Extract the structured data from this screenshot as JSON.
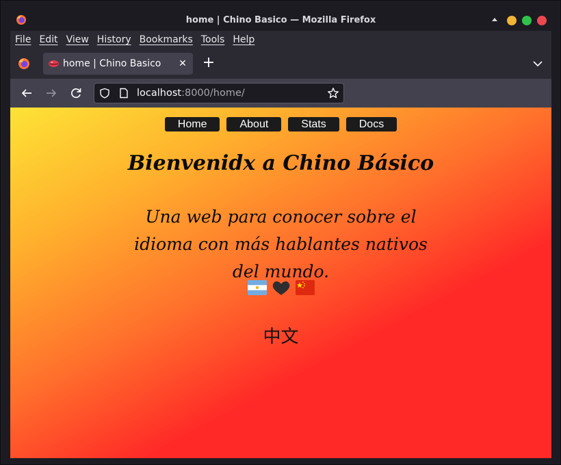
{
  "window": {
    "title": "home | Chino Basico — Mozilla Firefox"
  },
  "menu": [
    "File",
    "Edit",
    "View",
    "History",
    "Bookmarks",
    "Tools",
    "Help"
  ],
  "tab": {
    "title": "home | Chino Basico",
    "close_glyph": "✕",
    "new_tab_glyph": "+"
  },
  "urlbar": {
    "host": "localhost",
    "rest": ":8000/home/"
  },
  "page": {
    "nav": [
      "Home",
      "About",
      "Stats",
      "Docs"
    ],
    "heading": "Bienvenidx a Chino Básico",
    "subheading": "Una web para conocer sobre el idioma con más hablantes nativos del mundo.",
    "chinese": "中文",
    "flags": [
      "argentina-flag",
      "black-heart-icon",
      "china-flag"
    ]
  },
  "colors": {
    "gradient_start": "#fde336",
    "gradient_end": "#ff2a27",
    "nav_button": "#1c1b1b"
  }
}
